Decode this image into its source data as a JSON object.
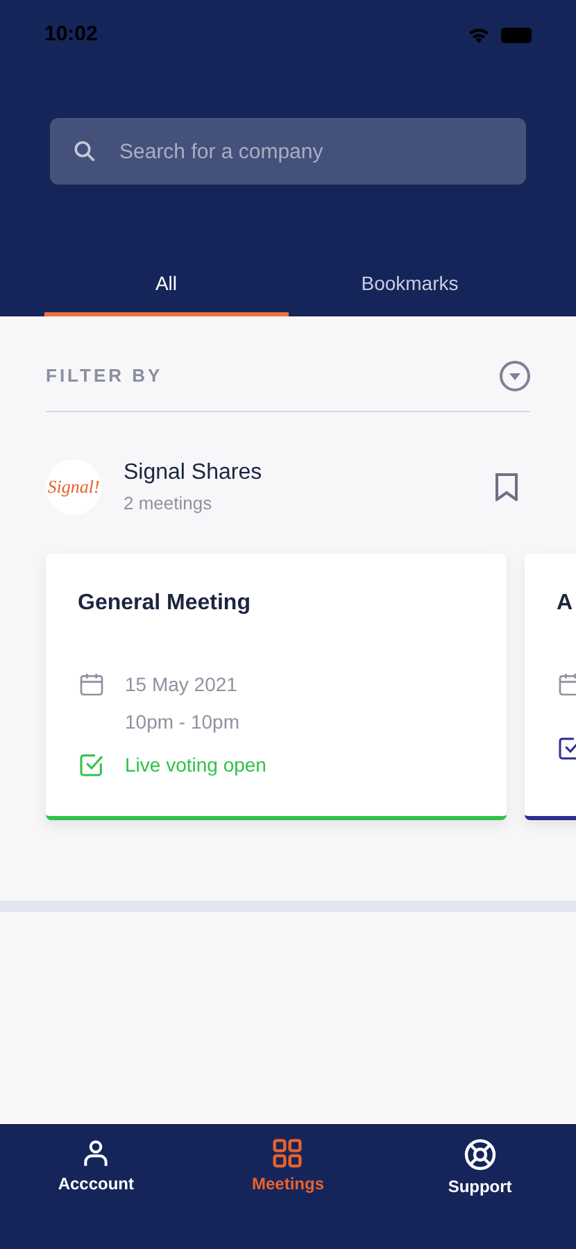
{
  "status_bar": {
    "time": "10:02"
  },
  "search": {
    "placeholder": "Search for a company"
  },
  "tabs": [
    {
      "label": "All",
      "selected": true
    },
    {
      "label": "Bookmarks",
      "selected": false
    }
  ],
  "filter": {
    "label": "FILTER BY"
  },
  "company": {
    "logo_text": "Signal!",
    "name": "Signal Shares",
    "meetings_count": "2 meetings",
    "bookmarked": false
  },
  "meetings": [
    {
      "title": "General Meeting",
      "date": "15 May 2021",
      "time": "10pm - 10pm",
      "status": "Live voting open",
      "color": "#2fc24a"
    },
    {
      "title": "A",
      "color": "#2a2f8f"
    }
  ],
  "nav": [
    {
      "label": "Acccount",
      "kind": "account",
      "selected": false
    },
    {
      "label": "Meetings",
      "kind": "meetings",
      "selected": true
    },
    {
      "label": "Support",
      "kind": "support",
      "selected": false
    }
  ]
}
